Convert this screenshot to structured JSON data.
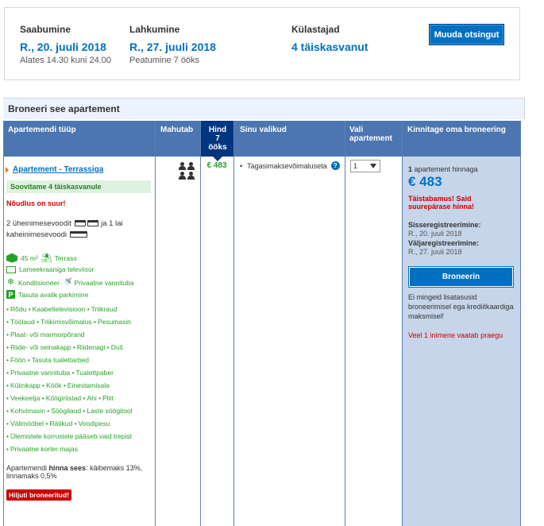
{
  "search": {
    "checkin_label": "Saabumine",
    "checkin_date": "R., 20. juuli 2018",
    "checkin_time": "Alates 14.30 kuni 24.00",
    "checkout_label": "Lahkumine",
    "checkout_date": "R., 27. juuli 2018",
    "stay_length": "Peatumine 7 ööks",
    "guests_label": "Külastajad",
    "guests_value": "4 täiskasvanut",
    "modify_button": "Muuda otsingut"
  },
  "section_title": "Broneeri see apartement",
  "table_headers": {
    "type": "Apartemendi tüüp",
    "capacity": "Mahutab",
    "price_line1": "Hind",
    "price_line2": "7",
    "price_line3": "ööks",
    "choices": "Sinu valikud",
    "select_line1": "Vali",
    "select_line2": "apartement",
    "confirm": "Kinnitage oma broneering"
  },
  "room": {
    "name": "Apartement - Terrassiga",
    "recommended": "Soovitame 4 täiskasvanule",
    "demand": "Nõudlus on suur!",
    "beds_part1": "2 üheinimesevoodit",
    "beds_part2": "ja 1 lai",
    "beds_part3": "kaheinimesevoodi",
    "facilities": [
      {
        "icon": "size-icon",
        "text": "45 m²",
        "extra_icon": "terrace-icon",
        "extra": "Terrass"
      },
      {
        "icon": "tv-icon",
        "text": "Lameekraaniga televiisor"
      },
      {
        "icon": "snowflake-icon",
        "text": "Konditsioneer",
        "extra_icon": "shower-icon",
        "extra": "Privaatne vannituba"
      },
      {
        "icon": "parking-icon",
        "text": "Tasuta avalik parkimine"
      }
    ],
    "amenity_lines": [
      [
        "Rõdu",
        "Kaabeltelevisioon",
        "Triikraud"
      ],
      [
        "Töölaud",
        "Triikimisvõimalus",
        "Pesumasin"
      ],
      [
        "Plaat- või marmorpõrand"
      ],
      [
        "Riide- või seinakapp",
        "Riidenagi",
        "Duš"
      ],
      [
        "Föön",
        "Tasuta tualettarbed"
      ],
      [
        "Privaatne vannituba",
        "Tualettpaber"
      ],
      [
        "Külmkapp",
        "Köök",
        "Einestamisala"
      ],
      [
        "Veekeetja",
        "Köögiriistad",
        "Ahi",
        "Pliit"
      ],
      [
        "Kohvimasin",
        "Söögilaud",
        "Laste söögitool"
      ],
      [
        "Välimööbel",
        "Rätikud",
        "Voodipesu"
      ],
      [
        "Ülemistele korrustele pääseb vaid trepist"
      ],
      [
        "Privaatne korter majas"
      ]
    ],
    "price_includes_label": "Apartemendi",
    "price_includes_bold": "hinna sees",
    "price_includes_rest": ": käibemaks 13%, linnamaks 0,5%",
    "sold_badge": "Hiljuti broneeritud!",
    "price": "€ 483",
    "choice": "Tagasimaksevõimaluseta",
    "select_value": "1"
  },
  "confirm": {
    "count": "1",
    "count_text": "apartement hinnaga",
    "price": "€ 483",
    "sold_out_msg": "Täistabamus! Said suurepärase hinna!",
    "checkin_label": "Sisseregistreerimine:",
    "checkin_date": "R., 20. juuli 2018",
    "checkout_label": "Väljaregistreerimine:",
    "checkout_date": "R., 27. juuli 2018",
    "book_button": "Broneerin",
    "no_fees": "Ei mingeid lisatasusid broneerimisel ega krediitkaardiga maksmisel!",
    "viewing": "Veel 1 inimene vaatab praegu"
  },
  "colors": {
    "brand_blue": "#0071c2",
    "header_blue": "#4b76b2",
    "price_header": "#003580",
    "green": "#26a326",
    "red": "#cc0000",
    "confirm_bg": "#c6d5ea"
  }
}
